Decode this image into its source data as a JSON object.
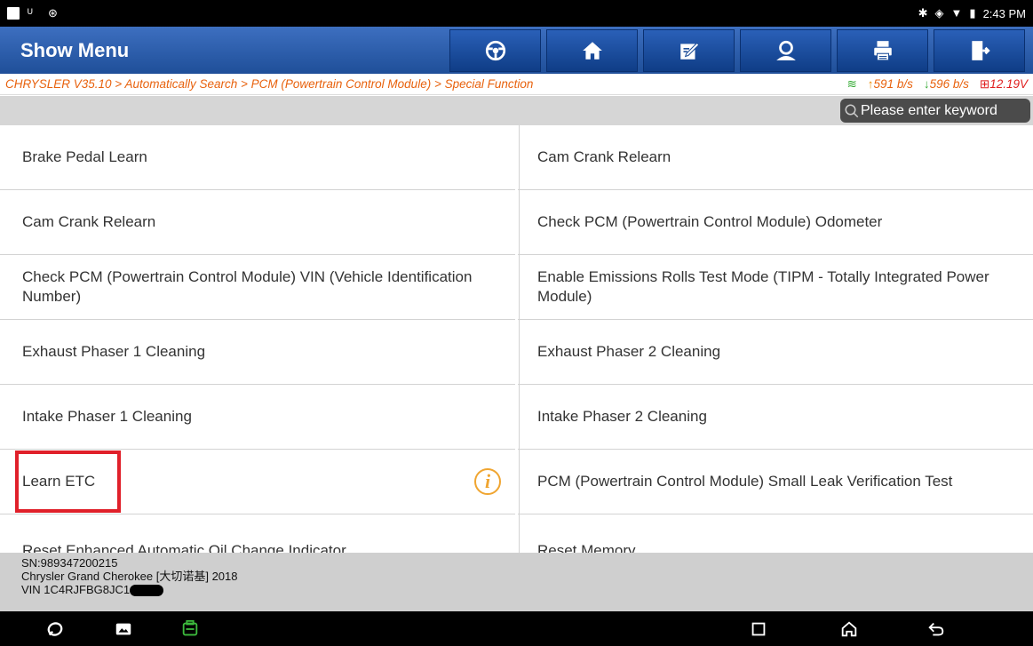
{
  "status": {
    "time": "2:43 PM"
  },
  "header": {
    "title": "Show Menu",
    "buttons": [
      "steering-wheel-icon",
      "home-icon",
      "edit-icon",
      "user-icon",
      "print-icon",
      "exit-icon"
    ]
  },
  "breadcrumb": {
    "path": "CHRYSLER V35.10 > Automatically Search > PCM (Powertrain Control Module) > Special Function",
    "upload": "591 b/s",
    "download": "596 b/s",
    "voltage": "12.19V"
  },
  "search": {
    "placeholder": "Please enter keyword"
  },
  "menu": {
    "rows": [
      {
        "left": "Brake Pedal Learn",
        "right": "Cam Crank Relearn"
      },
      {
        "left": "Cam Crank Relearn",
        "right": "Check PCM (Powertrain Control Module) Odometer"
      },
      {
        "left": "Check PCM (Powertrain Control Module) VIN (Vehicle Identification Number)",
        "right": "Enable Emissions Rolls Test Mode (TIPM - Totally Integrated Power Module)"
      },
      {
        "left": "Exhaust Phaser 1 Cleaning",
        "right": "Exhaust Phaser 2 Cleaning"
      },
      {
        "left": "Intake Phaser 1 Cleaning",
        "right": "Intake Phaser 2 Cleaning"
      },
      {
        "left": "Learn ETC",
        "right": "PCM (Powertrain Control Module) Small Leak Verification Test"
      },
      {
        "left": "Reset Enhanced Automatic Oil Change Indicator",
        "right": "Reset Memory"
      }
    ]
  },
  "footer": {
    "sn": "SN:989347200215",
    "vehicle": "Chrysler Grand Cherokee [大切诺基] 2018",
    "vin": "VIN 1C4RJFBG8JC1"
  },
  "colors": {
    "accent": "#1f4f99",
    "breadcrumb": "#e8620e",
    "highlight": "#e0202a"
  }
}
